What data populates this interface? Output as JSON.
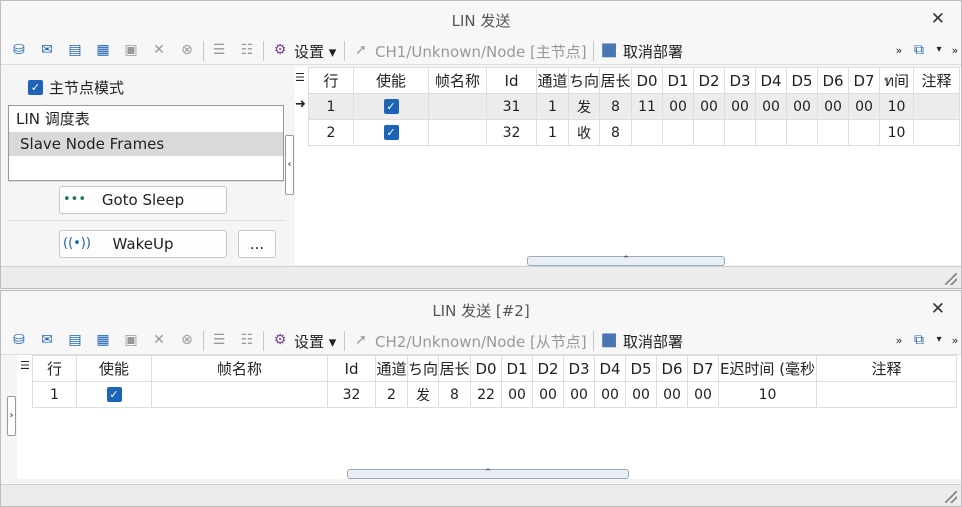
{
  "panel1": {
    "title": "LIN 发送",
    "close": "✕",
    "toolbar": {
      "settings_label": "设置",
      "node_label": "CH1/Unknown/Node [主节点]",
      "deploy_label": "取消部署"
    },
    "left": {
      "master_mode_label": "主节点模式",
      "list_items": [
        "LIN 调度表",
        "Slave Node Frames"
      ],
      "goto_sleep_label": "Goto Sleep",
      "wakeup_label": "WakeUp",
      "more_label": "..."
    },
    "table": {
      "headers": [
        "行",
        "使能",
        "帧名称",
        "Id",
        "通道",
        "方向",
        "长度",
        "D0",
        "D1",
        "D2",
        "D3",
        "D4",
        "D5",
        "D6",
        "D7",
        "时间",
        "注释"
      ],
      "header_display": [
        "行",
        "使能",
        "帧名称",
        "Id",
        "通道",
        "ち向",
        "居长",
        "D0",
        "D1",
        "D2",
        "D3",
        "D4",
        "D5",
        "D6",
        "D7",
        "ท间",
        "注释"
      ],
      "rows": [
        {
          "row": "1",
          "name": "",
          "id": "31",
          "ch": "1",
          "dir": "发",
          "len": "8",
          "d": [
            "11",
            "00",
            "00",
            "00",
            "00",
            "00",
            "00",
            "00"
          ],
          "time": "10",
          "note": ""
        },
        {
          "row": "2",
          "name": "",
          "id": "32",
          "ch": "1",
          "dir": "收",
          "len": "8",
          "d": [
            "",
            "",
            "",
            "",
            "",
            "",
            "",
            ""
          ],
          "time": "10",
          "note": ""
        }
      ]
    }
  },
  "panel2": {
    "title": "LIN 发送 [#2]",
    "close": "✕",
    "toolbar": {
      "settings_label": "设置",
      "node_label": "CH2/Unknown/Node [从节点]",
      "deploy_label": "取消部署"
    },
    "table": {
      "header_display": [
        "行",
        "使能",
        "帧名称",
        "Id",
        "通道",
        "ち向",
        "居长",
        "D0",
        "D1",
        "D2",
        "D3",
        "D4",
        "D5",
        "D6",
        "D7",
        "E迟时间 (毫秒",
        "注释"
      ],
      "rows": [
        {
          "row": "1",
          "name": "",
          "id": "32",
          "ch": "2",
          "dir": "发",
          "len": "8",
          "d": [
            "22",
            "00",
            "00",
            "00",
            "00",
            "00",
            "00",
            "00"
          ],
          "time": "10",
          "note": ""
        }
      ]
    }
  },
  "colors": {
    "accent": "#1d63b8",
    "selected_row": "#ececec",
    "header_bg": "#ffffff"
  },
  "icons": [
    "database-icon",
    "mail-icon",
    "copy-icon",
    "paste-icon",
    "lock-icon",
    "delete-icon",
    "cancel-icon",
    "grid-icon",
    "grid-clear-icon",
    "gear-icon",
    "cursor-icon",
    "stop-icon",
    "export-icon"
  ]
}
